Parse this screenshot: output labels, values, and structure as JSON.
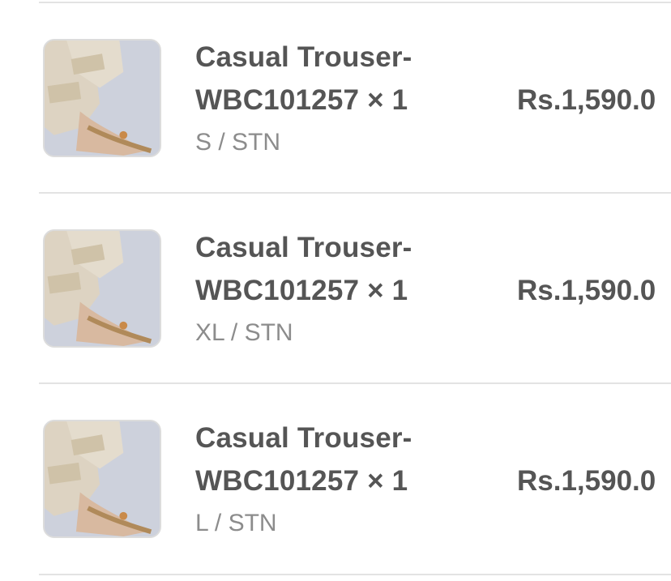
{
  "order_items": [
    {
      "title_line1": "Casual Trouser-",
      "title_line2": "WBC101257 × 1",
      "variant": "S / STN",
      "price": "Rs.1,590.0",
      "image_icon": "trouser-product-thumbnail"
    },
    {
      "title_line1": "Casual Trouser-",
      "title_line2": "WBC101257 × 1",
      "variant": "XL / STN",
      "price": "Rs.1,590.0",
      "image_icon": "trouser-product-thumbnail"
    },
    {
      "title_line1": "Casual Trouser-",
      "title_line2": "WBC101257 × 1",
      "variant": "L / STN",
      "price": "Rs.1,590.0",
      "image_icon": "trouser-product-thumbnail"
    }
  ],
  "colors": {
    "title": "#555555",
    "variant": "#8c8c8c",
    "divider": "#e3e3e3",
    "thumbnail_bg": "#cdd1dc"
  }
}
